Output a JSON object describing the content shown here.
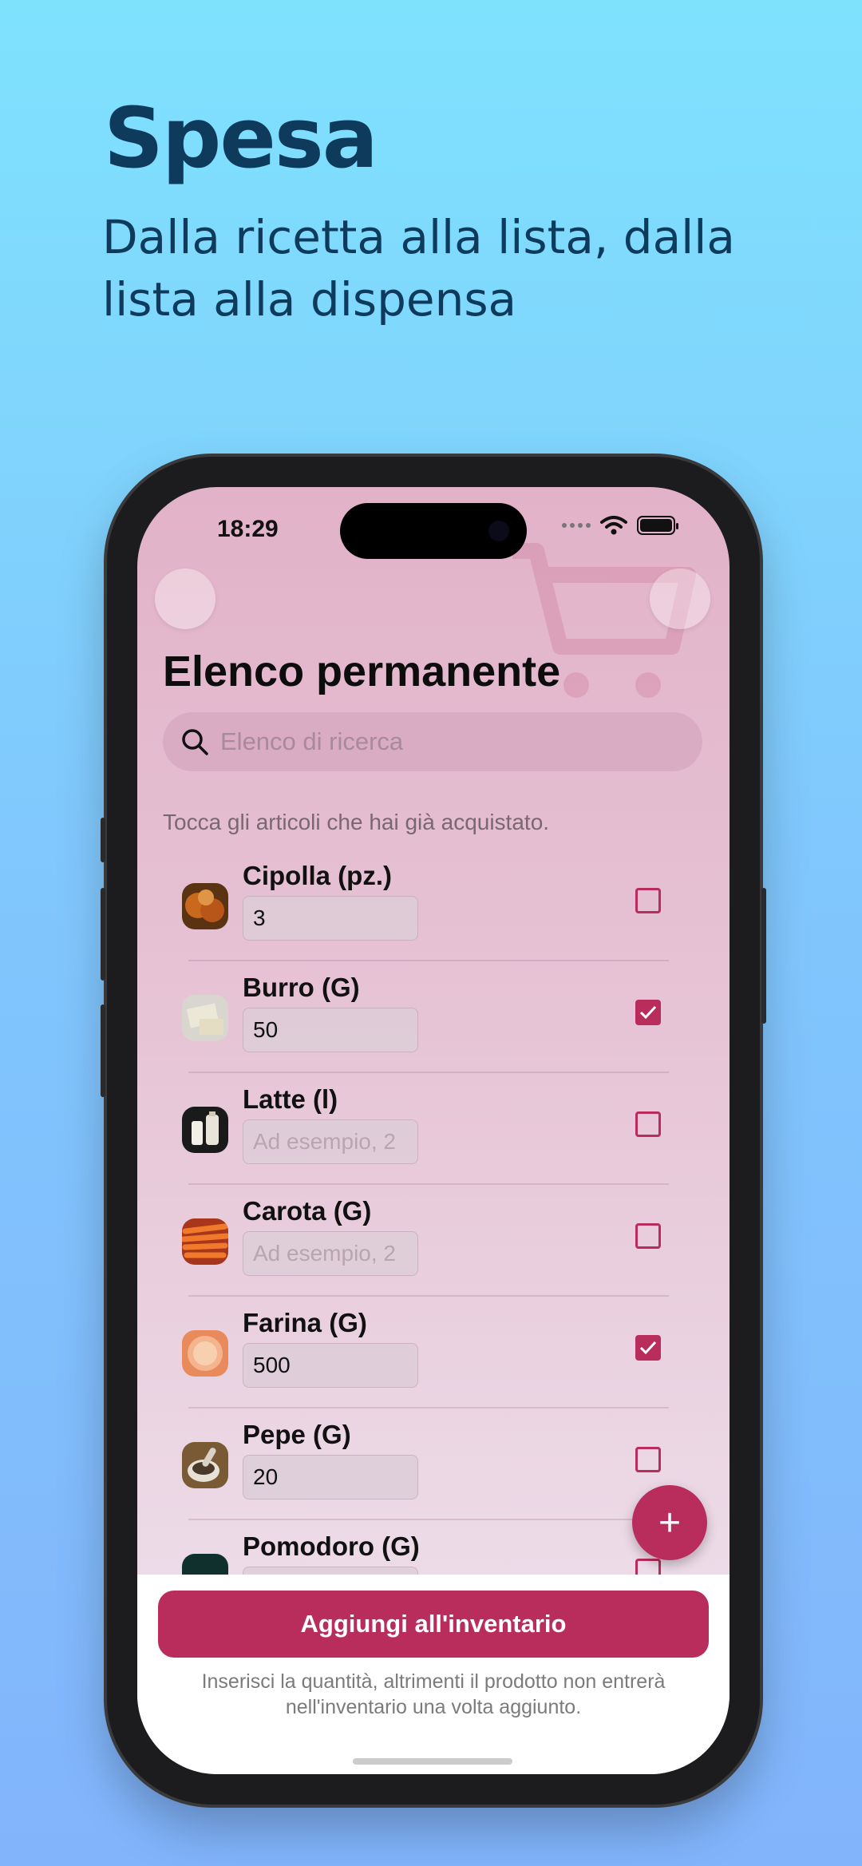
{
  "promo": {
    "title": "Spesa",
    "subtitle": "Dalla ricetta alla lista, dalla lista alla dispensa"
  },
  "status_bar": {
    "time": "18:29"
  },
  "screen": {
    "title": "Elenco permanente",
    "search_placeholder": "Elenco di ricerca",
    "hint": "Tocca gli articoli che hai già acquistato.",
    "accent_color": "#b92d5c"
  },
  "items": [
    {
      "name": "Cipolla (pz.)",
      "value": "3",
      "placeholder": "Ad esempio, 2",
      "checked": false
    },
    {
      "name": "Burro (G)",
      "value": "50",
      "placeholder": "Ad esempio, 2",
      "checked": true
    },
    {
      "name": "Latte (l)",
      "value": "",
      "placeholder": "Ad esempio, 2",
      "checked": false
    },
    {
      "name": "Carota (G)",
      "value": "",
      "placeholder": "Ad esempio, 2",
      "checked": false
    },
    {
      "name": "Farina (G)",
      "value": "500",
      "placeholder": "Ad esempio, 2",
      "checked": true
    },
    {
      "name": "Pepe (G)",
      "value": "20",
      "placeholder": "Ad esempio, 2",
      "checked": false
    },
    {
      "name": "Pomodoro (G)",
      "value": "",
      "placeholder": "Ad esempio, 2",
      "checked": false
    }
  ],
  "fab_label": "+",
  "bottom": {
    "button_label": "Aggiungi all'inventario",
    "footnote": "Inserisci la quantità, altrimenti il prodotto non entrerà nell'inventario una volta aggiunto."
  }
}
